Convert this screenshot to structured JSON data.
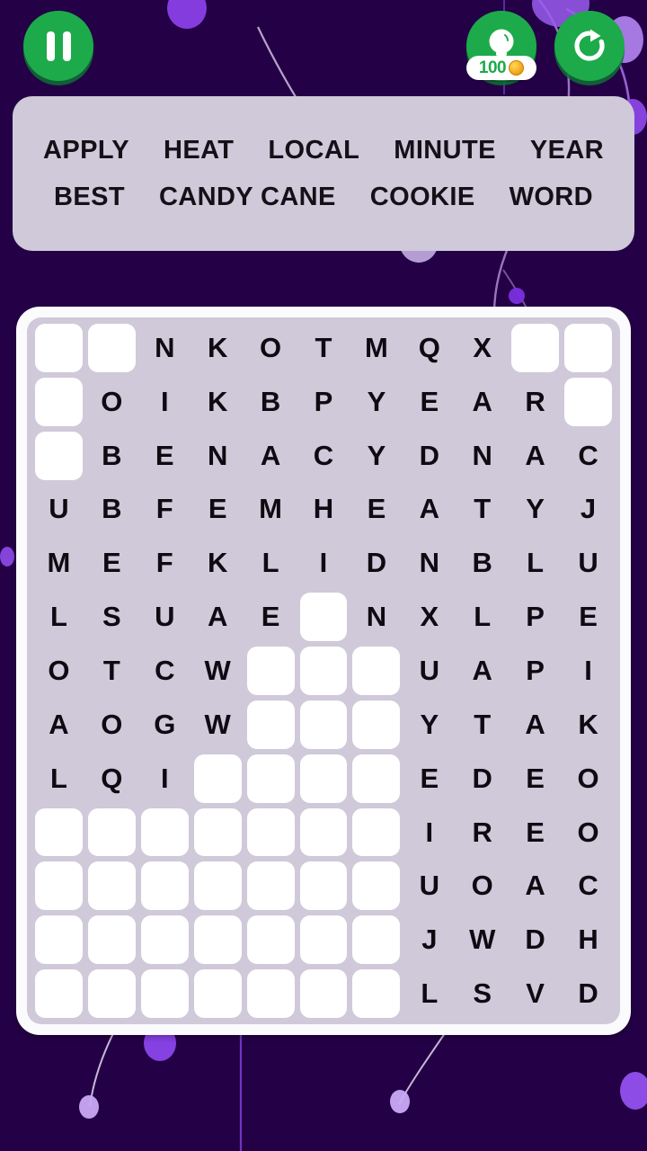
{
  "theme": {
    "background": "#240046",
    "panel": "#CFC9D9",
    "grid_frame": "#FBFAFD",
    "cell_found": "#FFFFFF",
    "letter_color": "#0E0A12",
    "button_green": "#1DAA4B",
    "coin_gold": "#F2A71B"
  },
  "topbar": {
    "pause_label": "pause-icon",
    "hint_label": "lightbulb-icon",
    "hint_cost": "100",
    "coin_symbol": "¢",
    "refresh_label": "refresh-icon"
  },
  "word_panel": {
    "rows": [
      [
        "APPLY",
        "HEAT",
        "LOCAL",
        "MINUTE",
        "YEAR"
      ],
      [
        "BEST",
        "CANDY CANE",
        "COOKIE",
        "WORD"
      ]
    ]
  },
  "grid": {
    "columns": 11,
    "rows": 13,
    "cells": [
      [
        "",
        "",
        "N",
        "K",
        "O",
        "T",
        "M",
        "Q",
        "X",
        "",
        ""
      ],
      [
        "",
        "O",
        "I",
        "K",
        "B",
        "P",
        "Y",
        "E",
        "A",
        "R",
        ""
      ],
      [
        "",
        "B",
        "E",
        "N",
        "A",
        "C",
        "Y",
        "D",
        "N",
        "A",
        "C"
      ],
      [
        "U",
        "B",
        "F",
        "E",
        "M",
        "H",
        "E",
        "A",
        "T",
        "Y",
        "J"
      ],
      [
        "M",
        "E",
        "F",
        "K",
        "L",
        "I",
        "D",
        "N",
        "B",
        "L",
        "U"
      ],
      [
        "L",
        "S",
        "U",
        "A",
        "E",
        "",
        "N",
        "X",
        "L",
        "P",
        "E"
      ],
      [
        "O",
        "T",
        "C",
        "W",
        "",
        "",
        "",
        "U",
        "A",
        "P",
        "I"
      ],
      [
        "A",
        "O",
        "G",
        "W",
        "",
        "",
        "",
        "Y",
        "T",
        "A",
        "K"
      ],
      [
        "L",
        "Q",
        "I",
        "",
        "",
        "",
        "",
        "E",
        "D",
        "E",
        "O"
      ],
      [
        "",
        "",
        "",
        "",
        "",
        "",
        "",
        "I",
        "R",
        "E",
        "O"
      ],
      [
        "",
        "",
        "",
        "",
        "",
        "",
        "",
        "U",
        "O",
        "A",
        "C"
      ],
      [
        "",
        "",
        "",
        "",
        "",
        "",
        "",
        "J",
        "W",
        "D",
        "H"
      ],
      [
        "",
        "",
        "",
        "",
        "",
        "",
        "",
        "L",
        "S",
        "V",
        "D"
      ]
    ]
  }
}
